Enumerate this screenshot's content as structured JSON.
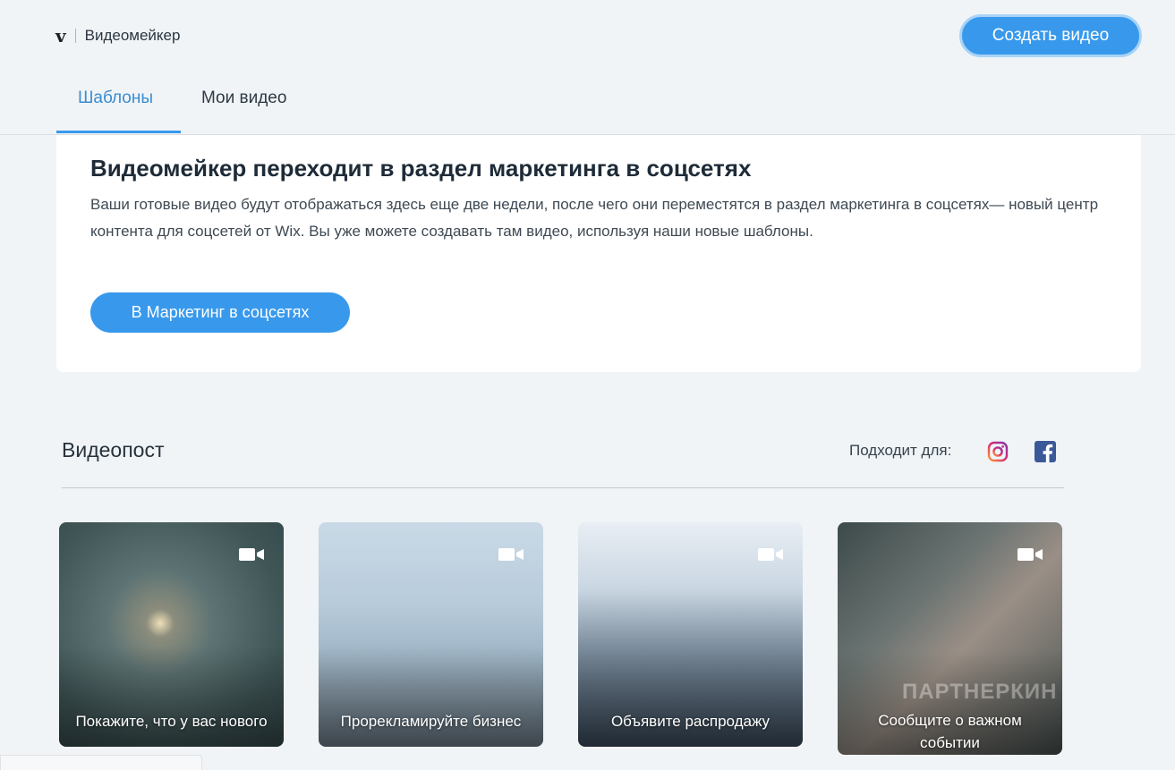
{
  "header": {
    "logo": "v",
    "app_name": "Видеомейкер",
    "create_button": "Создать видео",
    "tabs": [
      {
        "label": "Шаблоны",
        "active": true
      },
      {
        "label": "Мои видео",
        "active": false
      }
    ]
  },
  "banner": {
    "title": "Видеомейкер переходит в раздел маркетинга в соцсетях",
    "text": "Ваши готовые видео будут отображаться здесь еще две недели, после чего они переместятся в раздел маркетинга в соцсетях— новый центр контента для соцсетей от Wix. Вы уже можете создавать там видео, используя наши новые шаблоны.",
    "button": "В Маркетинг в соцсетях"
  },
  "section": {
    "title": "Видеопост",
    "fits_label": "Подходит для:",
    "platform_icons": [
      "instagram-icon",
      "facebook-icon"
    ]
  },
  "cards": [
    {
      "title": "Покажите, что у вас нового",
      "icon": "video-camera-icon"
    },
    {
      "title": "Прорекламируйте бизнес",
      "icon": "video-camera-icon"
    },
    {
      "title": "Объявите распродажу",
      "icon": "video-camera-icon"
    },
    {
      "title": "Сообщите о важном событии",
      "icon": "video-camera-icon"
    }
  ],
  "watermark": "ПАРТНЕРКИН",
  "colors": {
    "accent": "#3899ec",
    "page_bg": "#f0f4f7",
    "active_tab": "#3b8ccf"
  }
}
